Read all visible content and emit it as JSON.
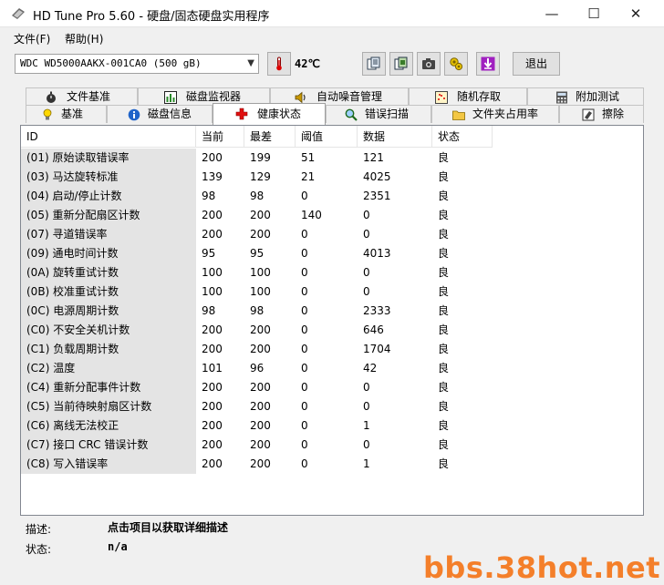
{
  "window": {
    "title": "HD Tune Pro 5.60 - 硬盘/固态硬盘实用程序"
  },
  "menu": {
    "file": "文件(F)",
    "help": "帮助(H)"
  },
  "toolbar": {
    "drive": "WDC WD5000AAKX-001CA0 (500 gB)",
    "temperature": "42℃",
    "exit_label": "退出",
    "icons": [
      "thermometer-icon",
      "copy-text-icon",
      "copy-screen-icon",
      "camera-icon",
      "settings-icon",
      "save-icon"
    ]
  },
  "tabs": {
    "row1": [
      "文件基准",
      "磁盘监视器",
      "自动噪音管理",
      "随机存取",
      "附加测试"
    ],
    "row2": [
      "基准",
      "磁盘信息",
      "健康状态",
      "错误扫描",
      "文件夹占用率",
      "擦除"
    ],
    "active": "健康状态"
  },
  "table": {
    "headers": [
      "ID",
      "当前",
      "最差",
      "阈值",
      "数据",
      "状态"
    ],
    "rows": [
      [
        "(01) 原始读取错误率",
        "200",
        "199",
        "51",
        "121",
        "良"
      ],
      [
        "(03) 马达旋转标准",
        "139",
        "129",
        "21",
        "4025",
        "良"
      ],
      [
        "(04) 启动/停止计数",
        "98",
        "98",
        "0",
        "2351",
        "良"
      ],
      [
        "(05) 重新分配扇区计数",
        "200",
        "200",
        "140",
        "0",
        "良"
      ],
      [
        "(07) 寻道错误率",
        "200",
        "200",
        "0",
        "0",
        "良"
      ],
      [
        "(09) 通电时间计数",
        "95",
        "95",
        "0",
        "4013",
        "良"
      ],
      [
        "(0A) 旋转重试计数",
        "100",
        "100",
        "0",
        "0",
        "良"
      ],
      [
        "(0B) 校准重试计数",
        "100",
        "100",
        "0",
        "0",
        "良"
      ],
      [
        "(0C) 电源周期计数",
        "98",
        "98",
        "0",
        "2333",
        "良"
      ],
      [
        "(C0) 不安全关机计数",
        "200",
        "200",
        "0",
        "646",
        "良"
      ],
      [
        "(C1) 负载周期计数",
        "200",
        "200",
        "0",
        "1704",
        "良"
      ],
      [
        "(C2) 温度",
        "101",
        "96",
        "0",
        "42",
        "良"
      ],
      [
        "(C4) 重新分配事件计数",
        "200",
        "200",
        "0",
        "0",
        "良"
      ],
      [
        "(C5) 当前待映射扇区计数",
        "200",
        "200",
        "0",
        "0",
        "良"
      ],
      [
        "(C6) 离线无法校正",
        "200",
        "200",
        "0",
        "1",
        "良"
      ],
      [
        "(C7) 接口 CRC 错误计数",
        "200",
        "200",
        "0",
        "0",
        "良"
      ],
      [
        "(C8) 写入错误率",
        "200",
        "200",
        "0",
        "1",
        "良"
      ]
    ]
  },
  "details": {
    "desc_label": "描述:",
    "desc_value": "点击项目以获取详细描述",
    "status_label": "状态:",
    "status_value": "n/a"
  },
  "watermark": "bbs.38hot.net"
}
